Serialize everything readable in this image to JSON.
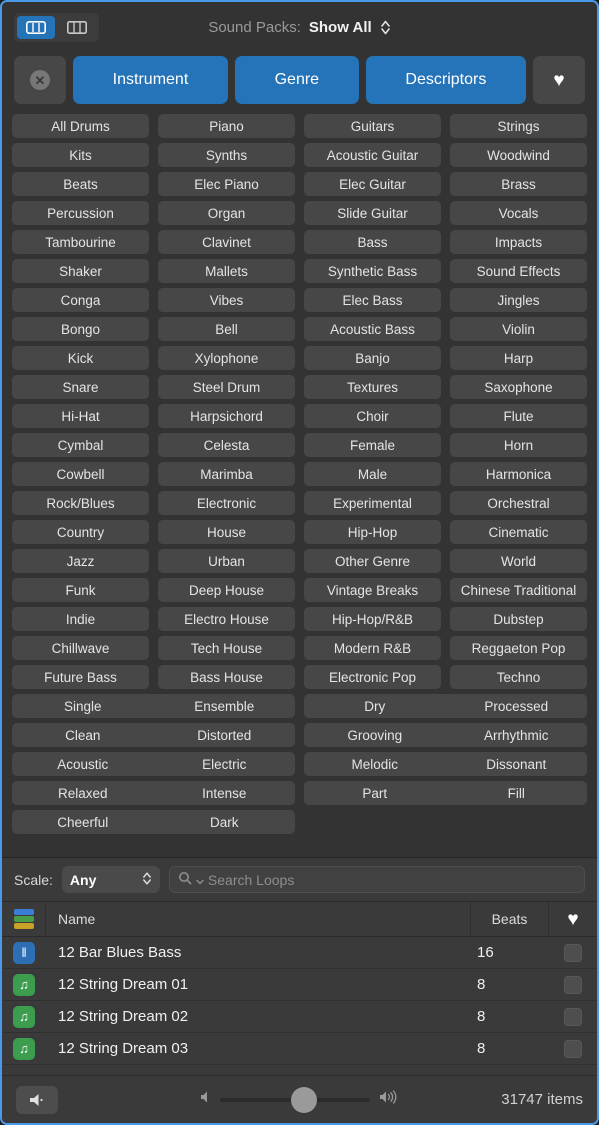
{
  "topbar": {
    "view_grid_icon": "columns-grid-icon",
    "view_list_icon": "columns-list-icon",
    "sound_packs_label": "Sound Packs:",
    "sound_packs_value": "Show All",
    "stepper_icon": "up-down-chevron-icon"
  },
  "filters": {
    "clear_icon": "clear-x-icon",
    "buttons": [
      {
        "label": "Instrument",
        "active": true
      },
      {
        "label": "Genre",
        "active": true
      },
      {
        "label": "Descriptors",
        "active": true
      }
    ],
    "favorites_icon": "heart-icon"
  },
  "keyword_grid": {
    "rows": [
      {
        "type": "quad",
        "cells": [
          "All Drums",
          "Piano",
          "Guitars",
          "Strings"
        ]
      },
      {
        "type": "quad",
        "cells": [
          "Kits",
          "Synths",
          "Acoustic Guitar",
          "Woodwind"
        ]
      },
      {
        "type": "quad",
        "cells": [
          "Beats",
          "Elec Piano",
          "Elec Guitar",
          "Brass"
        ]
      },
      {
        "type": "quad",
        "cells": [
          "Percussion",
          "Organ",
          "Slide Guitar",
          "Vocals"
        ]
      },
      {
        "type": "quad",
        "cells": [
          "Tambourine",
          "Clavinet",
          "Bass",
          "Impacts"
        ]
      },
      {
        "type": "quad",
        "cells": [
          "Shaker",
          "Mallets",
          "Synthetic Bass",
          "Sound Effects"
        ]
      },
      {
        "type": "quad",
        "cells": [
          "Conga",
          "Vibes",
          "Elec Bass",
          "Jingles"
        ]
      },
      {
        "type": "quad",
        "cells": [
          "Bongo",
          "Bell",
          "Acoustic Bass",
          "Violin"
        ]
      },
      {
        "type": "quad",
        "cells": [
          "Kick",
          "Xylophone",
          "Banjo",
          "Harp"
        ]
      },
      {
        "type": "quad",
        "cells": [
          "Snare",
          "Steel Drum",
          "Textures",
          "Saxophone"
        ]
      },
      {
        "type": "quad",
        "cells": [
          "Hi-Hat",
          "Harpsichord",
          "Choir",
          "Flute"
        ]
      },
      {
        "type": "quad",
        "cells": [
          "Cymbal",
          "Celesta",
          "Female",
          "Horn"
        ]
      },
      {
        "type": "quad",
        "cells": [
          "Cowbell",
          "Marimba",
          "Male",
          "Harmonica"
        ]
      },
      {
        "type": "quad",
        "cells": [
          "Rock/Blues",
          "Electronic",
          "Experimental",
          "Orchestral"
        ]
      },
      {
        "type": "quad",
        "cells": [
          "Country",
          "House",
          "Hip-Hop",
          "Cinematic"
        ]
      },
      {
        "type": "quad",
        "cells": [
          "Jazz",
          "Urban",
          "Other Genre",
          "World"
        ]
      },
      {
        "type": "quad",
        "cells": [
          "Funk",
          "Deep House",
          "Vintage Breaks",
          "Chinese Traditional"
        ]
      },
      {
        "type": "quad",
        "cells": [
          "Indie",
          "Electro House",
          "Hip-Hop/R&B",
          "Dubstep"
        ]
      },
      {
        "type": "quad",
        "cells": [
          "Chillwave",
          "Tech House",
          "Modern R&B",
          "Reggaeton Pop"
        ]
      },
      {
        "type": "quad",
        "cells": [
          "Future Bass",
          "Bass House",
          "Electronic Pop",
          "Techno"
        ]
      },
      {
        "type": "pair",
        "cells": [
          "Single",
          "Ensemble",
          "Dry",
          "Processed"
        ]
      },
      {
        "type": "pair",
        "cells": [
          "Clean",
          "Distorted",
          "Grooving",
          "Arrhythmic"
        ]
      },
      {
        "type": "pair",
        "cells": [
          "Acoustic",
          "Electric",
          "Melodic",
          "Dissonant"
        ]
      },
      {
        "type": "pair",
        "cells": [
          "Relaxed",
          "Intense",
          "Part",
          "Fill"
        ]
      },
      {
        "type": "pair-single",
        "cells": [
          "Cheerful",
          "Dark"
        ]
      }
    ]
  },
  "scalerow": {
    "scale_label": "Scale:",
    "scale_value": "Any",
    "scale_stepper_icon": "up-down-chevron-icon",
    "search_icon": "search-icon",
    "search_chevron_icon": "chevron-down-icon",
    "search_placeholder": "Search Loops",
    "search_value": ""
  },
  "list_header": {
    "sort_icon": "color-stack-icon",
    "name": "Name",
    "beats": "Beats",
    "favorite_icon": "heart-icon"
  },
  "loops": [
    {
      "icon": "waveform-icon",
      "icon_color": "#2d6fb5",
      "glyph": "‖",
      "name": "12 Bar Blues Bass",
      "beats": "16",
      "favorite": false
    },
    {
      "icon": "music-note-icon",
      "icon_color": "#3c9d4e",
      "glyph": "♫",
      "name": "12 String Dream 01",
      "beats": "8",
      "favorite": false
    },
    {
      "icon": "music-note-icon",
      "icon_color": "#3c9d4e",
      "glyph": "♫",
      "name": "12 String Dream 02",
      "beats": "8",
      "favorite": false
    },
    {
      "icon": "music-note-icon",
      "icon_color": "#3c9d4e",
      "glyph": "♫",
      "name": "12 String Dream 03",
      "beats": "8",
      "favorite": false
    }
  ],
  "bottombar": {
    "speaker_button_icon": "speaker-icon",
    "volume_min_icon": "speaker-low-icon",
    "volume_max_icon": "speaker-high-icon",
    "volume_percent": 56,
    "item_count": "31747 items"
  },
  "colors": {
    "accent_blue": "#2573b8",
    "window_border": "#4a9aea",
    "background": "#333333",
    "button_gray": "#474747",
    "panel_gray": "#3a3a3a",
    "stack_blue": "#3a7fd5",
    "stack_green": "#4a9e4a",
    "stack_yellow": "#c9a227"
  }
}
